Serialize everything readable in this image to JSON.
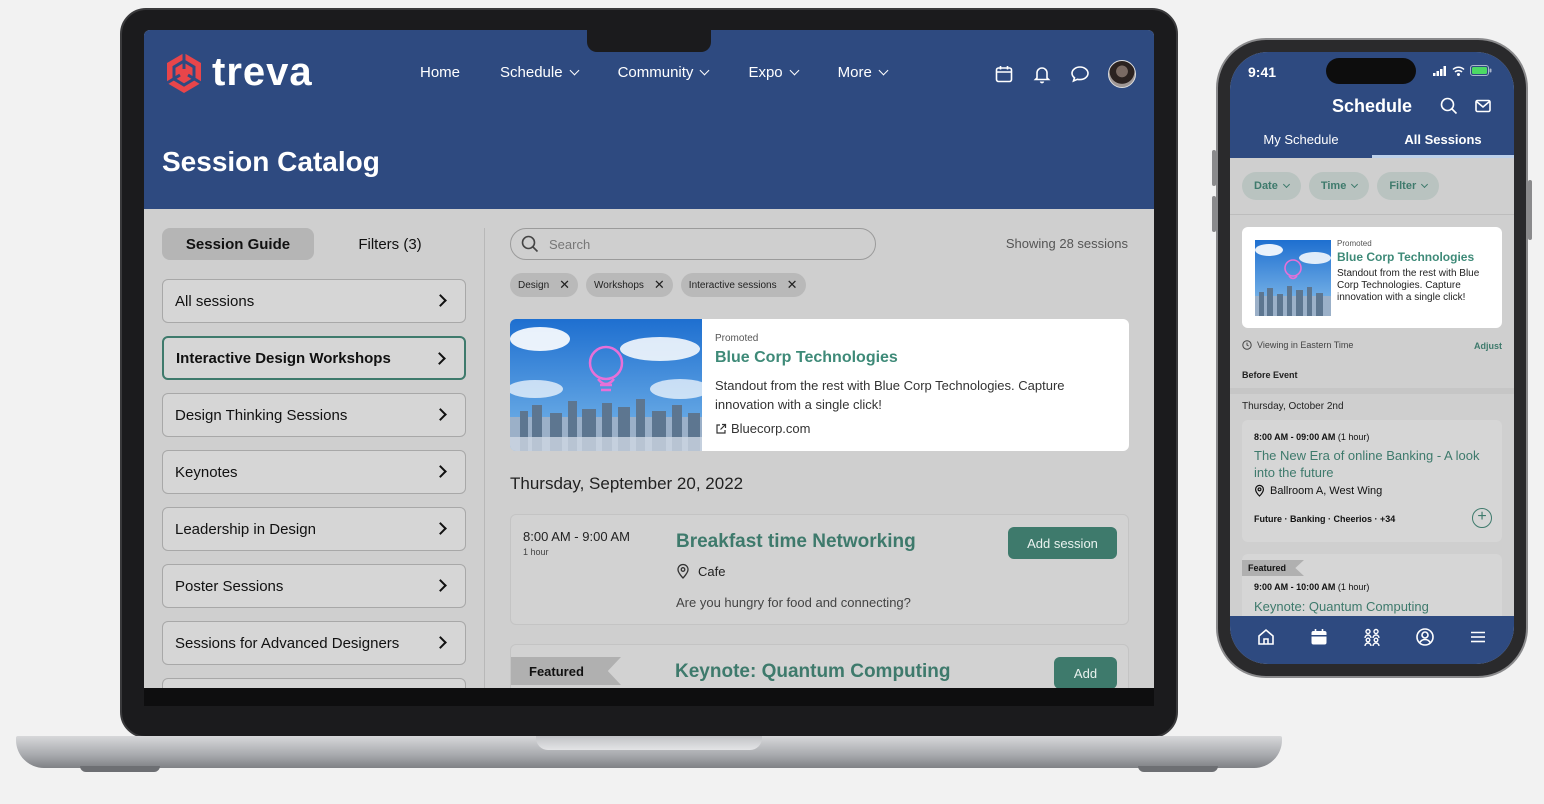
{
  "laptop": {
    "brand": "treva",
    "nav": [
      {
        "label": "Home",
        "has_dropdown": false
      },
      {
        "label": "Schedule",
        "has_dropdown": true
      },
      {
        "label": "Community",
        "has_dropdown": true
      },
      {
        "label": "Expo",
        "has_dropdown": true
      },
      {
        "label": "More",
        "has_dropdown": true
      }
    ],
    "page_title": "Session Catalog",
    "sidebar": {
      "tab_guide": "Session Guide",
      "tab_filters": "Filters (3)",
      "items": [
        {
          "label": "All sessions"
        },
        {
          "label": "Interactive Design Workshops"
        },
        {
          "label": "Design Thinking Sessions"
        },
        {
          "label": "Keynotes"
        },
        {
          "label": "Leadership in Design"
        },
        {
          "label": "Poster Sessions"
        },
        {
          "label": "Sessions for Advanced Designers"
        }
      ]
    },
    "search": {
      "placeholder": "Search"
    },
    "showing": "Showing 28 sessions",
    "chips": [
      {
        "label": "Design"
      },
      {
        "label": "Workshops"
      },
      {
        "label": "Interactive sessions"
      }
    ],
    "promo": {
      "label": "Promoted",
      "title": "Blue Corp Technologies",
      "description": "Standout from the rest with Blue Corp Technologies. Capture innovation with a single click!",
      "link": "Bluecorp.com"
    },
    "date_heading": "Thursday, September 20, 2022",
    "session1": {
      "time": "8:00 AM - 9:00 AM",
      "duration": "1 hour",
      "title": "Breakfast time Networking",
      "location": "Cafe",
      "description": "Are you hungry for food and connecting?",
      "button": "Add session"
    },
    "session2": {
      "badge": "Featured",
      "title": "Keynote: Quantum Computing",
      "button": "Add"
    }
  },
  "phone": {
    "status_time": "9:41",
    "title": "Schedule",
    "tabs": {
      "my": "My Schedule",
      "all": "All Sessions"
    },
    "filters": [
      {
        "label": "Date"
      },
      {
        "label": "Time"
      },
      {
        "label": "Filter"
      }
    ],
    "promo": {
      "label": "Promoted",
      "title": "Blue Corp Technologies",
      "description": "Standout from the rest with Blue Corp Technologies. Capture innovation with a single click!"
    },
    "timezone": "Viewing in Eastern Time",
    "adjust": "Adjust",
    "before_event": "Before Event",
    "day": "Thursday, October 2nd",
    "card1": {
      "time": "8:00 AM - 09:00 AM",
      "duration": "(1 hour)",
      "title": "The New Era of online Banking - A look into the future",
      "location": "Ballroom A, West Wing",
      "tags": "Future  ·  Banking  ·  Cheerios  ·  +34"
    },
    "card2": {
      "badge": "Featured",
      "time": "9:00 AM - 10:00 AM",
      "duration": "(1 hour)",
      "title": "Keynote: Quantum Computing"
    }
  },
  "colors": {
    "header_blue": "#2e4a80",
    "accent_green": "#3e7a6c",
    "brand_red": "#e8454a"
  }
}
